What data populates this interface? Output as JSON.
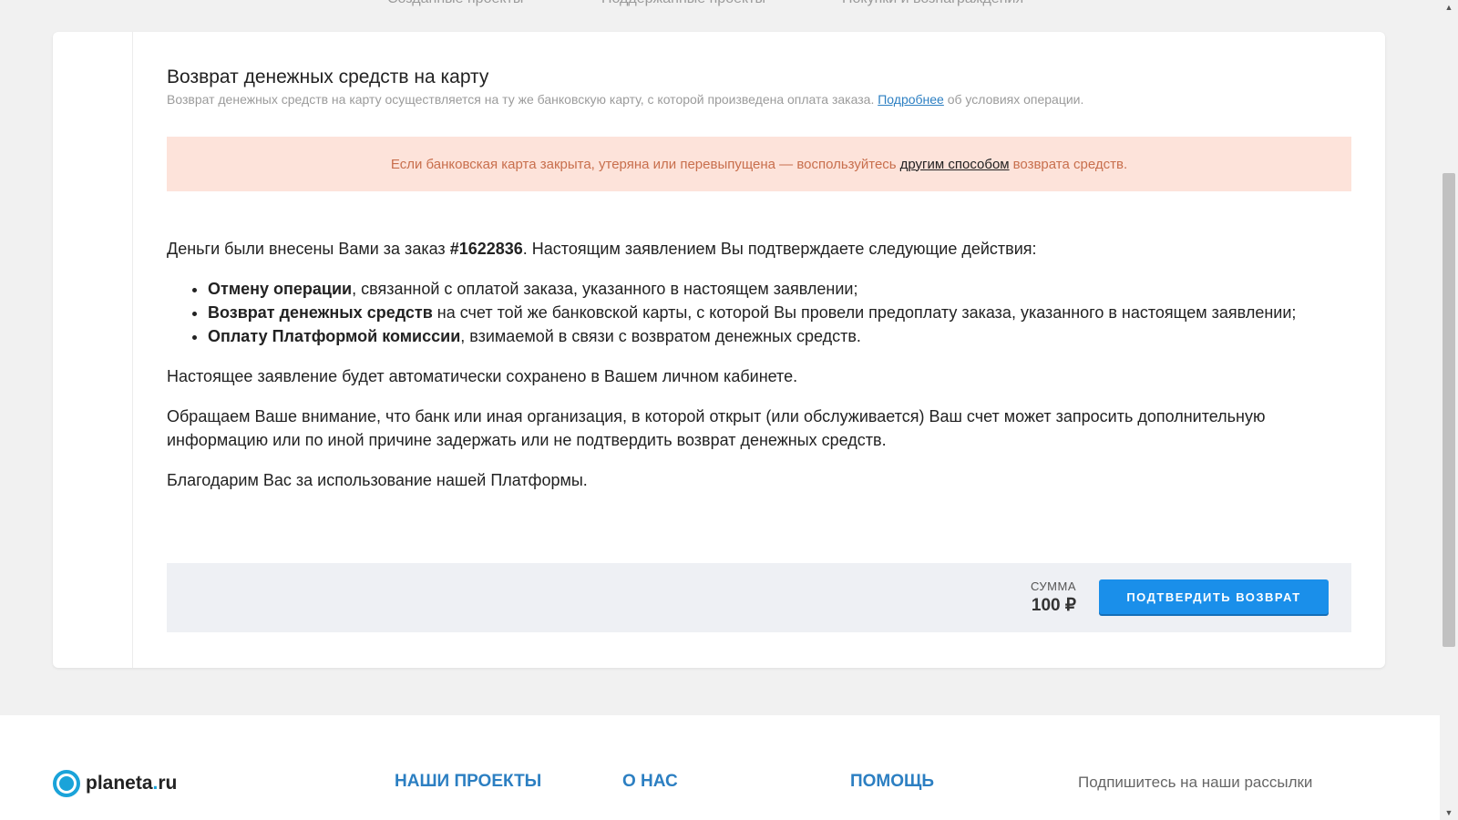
{
  "top_tabs": [
    "Созданные проекты",
    "Поддержанные проекты",
    "Покупки и вознаграждения"
  ],
  "refund": {
    "title": "Возврат денежных средств на карту",
    "subtitle_before": "Возврат денежных средств на карту осуществляется на ту же банковскую карту, с которой произведена оплата заказа.",
    "subtitle_link": "Подробнее",
    "subtitle_after": "об условиях операции.",
    "alert_before": "Если банковская карта закрыта, утеряна или перевыпущена — воспользуйтесь",
    "alert_link": "другим способом",
    "alert_after": "возврата средств.",
    "intro_before": "Деньги были внесены Вами за заказ",
    "order_number": "#1622836",
    "intro_after": ". Настоящим заявлением Вы подтверждаете следующие действия:",
    "bullets": [
      {
        "bold": "Отмену операции",
        "text": ", связанной с оплатой заказа, указанного в настоящем заявлении;"
      },
      {
        "bold": "Возврат денежных средств",
        "text": " на счет той же банковской карты, с которой Вы провели предоплату заказа, указанного в настоящем заявлении;"
      },
      {
        "bold": "Оплату Платформой комиссии",
        "text": ", взимаемой в связи с возвратом денежных средств."
      }
    ],
    "saved_note": "Настоящее заявление будет автоматически сохранено в Вашем личном кабинете.",
    "warning": "Обращаем Ваше внимание, что банк или иная организация, в которой открыт (или обслуживается) Ваш счет может запросить дополнительную информацию или по иной причине задержать или не подтвердить возврат денежных средств.",
    "thanks": "Благодарим Вас за использование нашей Платформы.",
    "sum_label": "СУММА",
    "sum_value": "100 ₽",
    "confirm_label": "ПОДТВЕРДИТЬ ВОЗВРАТ"
  },
  "footer": {
    "logo_main": "planeta",
    "logo_dot": ".",
    "logo_tld": "ru",
    "nav": [
      "НАШИ ПРОЕКТЫ",
      "О НАС",
      "ПОМОЩЬ"
    ],
    "subscribe": "Подпишитесь на наши рассылки"
  },
  "colors": {
    "accent": "#1a8fea",
    "link": "#2c7fc2",
    "alert_bg": "#fde3da",
    "alert_text": "#c86f4d",
    "logo": "#1aa3d9"
  }
}
